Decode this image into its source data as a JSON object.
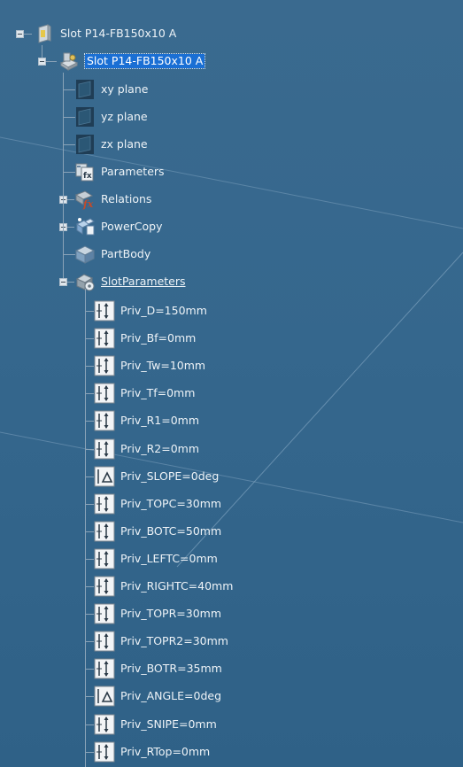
{
  "tree": {
    "root": {
      "label": "Slot P14-FB150x10 A",
      "icon": "product-icon",
      "expanded": true
    },
    "part": {
      "label": "Slot P14-FB150x10 A",
      "icon": "part-icon",
      "selected": true,
      "expanded": true
    },
    "children": [
      {
        "label": "xy plane",
        "icon": "plane-icon"
      },
      {
        "label": "yz plane",
        "icon": "plane-icon"
      },
      {
        "label": "zx plane",
        "icon": "plane-icon"
      },
      {
        "label": "Parameters",
        "icon": "parameters-icon"
      },
      {
        "label": "Relations",
        "icon": "relations-icon",
        "collapsed": true
      },
      {
        "label": "PowerCopy",
        "icon": "powercopy-icon",
        "collapsed": true
      },
      {
        "label": "PartBody",
        "icon": "partbody-icon"
      },
      {
        "label": "SlotParameters",
        "icon": "parameter-set-icon",
        "expanded": true,
        "underlined": true
      }
    ],
    "slot_parameters": [
      {
        "label": "Priv_D=150mm",
        "icon": "length-parameter-icon"
      },
      {
        "label": "Priv_Bf=0mm",
        "icon": "length-parameter-icon"
      },
      {
        "label": "Priv_Tw=10mm",
        "icon": "length-parameter-icon"
      },
      {
        "label": "Priv_Tf=0mm",
        "icon": "length-parameter-icon"
      },
      {
        "label": "Priv_R1=0mm",
        "icon": "length-parameter-icon"
      },
      {
        "label": "Priv_R2=0mm",
        "icon": "length-parameter-icon"
      },
      {
        "label": "Priv_SLOPE=0deg",
        "icon": "angle-parameter-icon"
      },
      {
        "label": "Priv_TOPC=30mm",
        "icon": "length-parameter-icon"
      },
      {
        "label": "Priv_BOTC=50mm",
        "icon": "length-parameter-icon"
      },
      {
        "label": "Priv_LEFTC=0mm",
        "icon": "length-parameter-icon"
      },
      {
        "label": "Priv_RIGHTC=40mm",
        "icon": "length-parameter-icon"
      },
      {
        "label": "Priv_TOPR=30mm",
        "icon": "length-parameter-icon"
      },
      {
        "label": "Priv_TOPR2=30mm",
        "icon": "length-parameter-icon"
      },
      {
        "label": "Priv_BOTR=35mm",
        "icon": "length-parameter-icon"
      },
      {
        "label": "Priv_ANGLE=0deg",
        "icon": "angle-parameter-icon"
      },
      {
        "label": "Priv_SNIPE=0mm",
        "icon": "length-parameter-icon"
      },
      {
        "label": "Priv_RTop=0mm",
        "icon": "length-parameter-icon"
      }
    ]
  },
  "colors": {
    "background": "#35678d",
    "tree_line": "#8aa3b8",
    "selection": "#1a6fd4"
  }
}
